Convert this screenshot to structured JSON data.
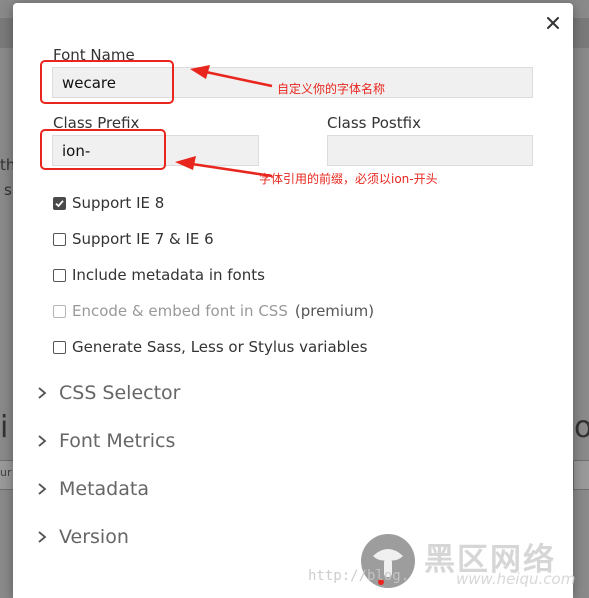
{
  "background": {
    "fragments": [
      "th",
      "s",
      "i",
      "ou",
      "ur"
    ]
  },
  "modal": {
    "close_icon": "close-icon",
    "font_name": {
      "label": "Font Name",
      "value": "wecare"
    },
    "class_prefix": {
      "label": "Class Prefix",
      "value": "ion-"
    },
    "class_postfix": {
      "label": "Class Postfix",
      "value": ""
    },
    "options": [
      {
        "label": "Support IE 8",
        "checked": true,
        "disabled": false
      },
      {
        "label": "Support IE 7 & IE 6",
        "checked": false,
        "disabled": false
      },
      {
        "label": "Include metadata in fonts",
        "checked": false,
        "disabled": false
      },
      {
        "label": "Encode & embed font in CSS",
        "suffix": "(premium)",
        "checked": false,
        "disabled": true
      },
      {
        "label": "Generate Sass, Less or Stylus variables",
        "checked": false,
        "disabled": false
      }
    ],
    "sections": [
      "CSS Selector",
      "Font Metrics",
      "Metadata",
      "Version"
    ]
  },
  "annotations": {
    "font_name_note": "自定义你的字体名称",
    "class_prefix_note": "字体引用的前缀，必须以ion-开头",
    "color": "#e8261e"
  },
  "watermark": {
    "brand": "黑区网络",
    "url": "http://blog.",
    "domain": "www.heiqu.com"
  }
}
